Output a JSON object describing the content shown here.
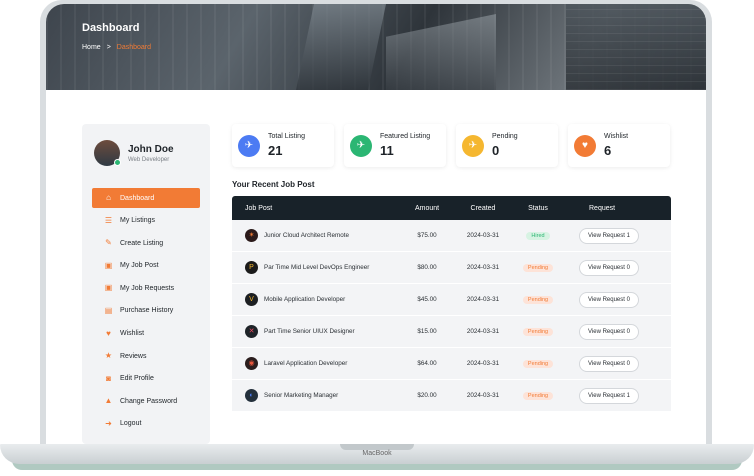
{
  "laptop": {
    "label": "MacBook"
  },
  "hero": {
    "title": "Dashboard",
    "breadcrumb": [
      "Home",
      ">",
      "Dashboard"
    ]
  },
  "profile": {
    "name": "John Doe",
    "role": "Web Developer"
  },
  "sidebar": {
    "items": [
      {
        "label": "Dashboard",
        "icon": "home-icon",
        "active": true
      },
      {
        "label": "My Listings",
        "icon": "list-icon"
      },
      {
        "label": "Create Listing",
        "icon": "edit-icon"
      },
      {
        "label": "My Job Post",
        "icon": "briefcase-icon"
      },
      {
        "label": "My Job Requests",
        "icon": "briefcase-icon"
      },
      {
        "label": "Purchase History",
        "icon": "receipt-icon"
      },
      {
        "label": "Wishlist",
        "icon": "heart-icon"
      },
      {
        "label": "Reviews",
        "icon": "star-icon"
      },
      {
        "label": "Edit Profile",
        "icon": "user-icon"
      },
      {
        "label": "Change Password",
        "icon": "lock-icon"
      },
      {
        "label": "Logout",
        "icon": "logout-icon"
      }
    ]
  },
  "stats": [
    {
      "label": "Total Listing",
      "value": "21",
      "color": "#4c7bf3",
      "icon": "rocket-icon"
    },
    {
      "label": "Featured Listing",
      "value": "11",
      "color": "#2bb673",
      "icon": "rocket-icon"
    },
    {
      "label": "Pending",
      "value": "0",
      "color": "#f5b730",
      "icon": "rocket-icon"
    },
    {
      "label": "Wishlist",
      "value": "6",
      "color": "#f27b35",
      "icon": "heart-icon"
    }
  ],
  "table": {
    "title": "Your Recent Job Post",
    "headers": [
      "Job Post",
      "Amount",
      "Created",
      "Status",
      "Request"
    ],
    "rows": [
      {
        "job": "Junior Cloud Architect Remote",
        "amount": "$75.00",
        "created": "2024-03-31",
        "status": "Hired",
        "request": "View Request 1"
      },
      {
        "job": "Par Time Mid Level DevOps Engineer",
        "amount": "$80.00",
        "created": "2024-03-31",
        "status": "Pending",
        "request": "View Request 0"
      },
      {
        "job": "Mobile Application Developer",
        "amount": "$45.00",
        "created": "2024-03-31",
        "status": "Pending",
        "request": "View Request 0"
      },
      {
        "job": "Part Time Senior UIUX Designer",
        "amount": "$15.00",
        "created": "2024-03-31",
        "status": "Pending",
        "request": "View Request 0"
      },
      {
        "job": "Laravel Application Developer",
        "amount": "$64.00",
        "created": "2024-03-31",
        "status": "Pending",
        "request": "View Request 0"
      },
      {
        "job": "Senior Marketing Manager",
        "amount": "$20.00",
        "created": "2024-03-31",
        "status": "Pending",
        "request": "View Request 1"
      }
    ]
  },
  "colors": {
    "accent": "#f27b35",
    "dark": "#182229",
    "hired": "#2bb673"
  }
}
